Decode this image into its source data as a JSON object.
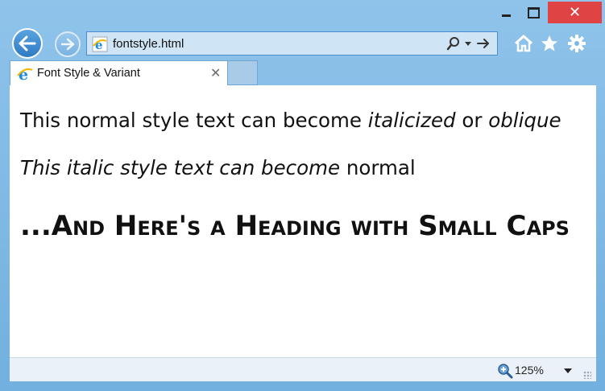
{
  "window": {
    "close_glyph": "✕"
  },
  "address_bar": {
    "url": "fontstyle.html"
  },
  "tabs": [
    {
      "title": "Font Style & Variant",
      "close_glyph": "✕"
    }
  ],
  "content": {
    "para1": {
      "normal": "This normal style text can become ",
      "italic1": "italicized",
      "mid": " or ",
      "italic2": "oblique"
    },
    "para2": {
      "italic": "This italic style text can become",
      "normal": " normal"
    },
    "heading": "...And Here's a Heading with Small Caps"
  },
  "status_bar": {
    "zoom": "125%"
  },
  "colors": {
    "frame": "#7db7e3",
    "close": "#e04343",
    "ie_blue": "#1f8be0",
    "ie_ring": "#f2b600"
  },
  "icons": [
    "back-arrow-icon",
    "forward-arrow-icon",
    "ie-page-icon",
    "search-icon",
    "go-arrow-icon",
    "home-icon",
    "star-icon",
    "gear-icon",
    "zoom-icon",
    "resize-grip-icon"
  ]
}
